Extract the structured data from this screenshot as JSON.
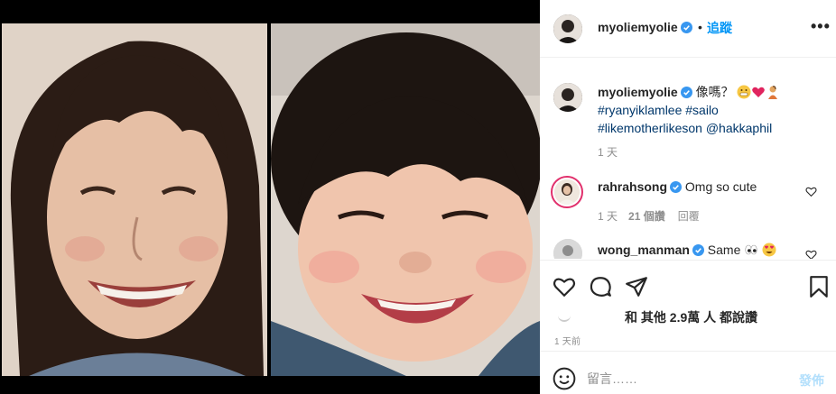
{
  "post": {
    "author": "myoliemyolie",
    "follow_label": "追蹤",
    "separator": "•",
    "more_label": "•••",
    "caption": {
      "author": "myoliemyolie",
      "text": "像嗎？",
      "hashtags_line1": "#ryanyiklamlee #sailo",
      "hashtags_line2": "#likemotherlikeson",
      "mention": "@hakkaphil",
      "time": "1 天"
    },
    "comments": [
      {
        "user": "rahrahsong",
        "text": "Omg so cute",
        "time": "1 天",
        "likes": "21 個讚",
        "reply_label": "回覆"
      },
      {
        "user": "wong_manman",
        "text": "Same"
      }
    ],
    "likes_text": "和 其他 2.9萬 人 都說讚",
    "posted_time": "1 天前"
  },
  "compose": {
    "placeholder": "留言……",
    "post_label": "發佈"
  },
  "colors": {
    "accent_blue": "#0095f6",
    "post_disabled": "#b2dffc",
    "text": "#262626",
    "muted": "#8e8e8e",
    "story_ring": "#e1306c",
    "heart_red": "#ed4956"
  },
  "icons": [
    "verified-badge-icon",
    "heart-icon",
    "comment-icon",
    "share-icon",
    "bookmark-icon",
    "smile-emoji-icon",
    "more-options-icon"
  ]
}
